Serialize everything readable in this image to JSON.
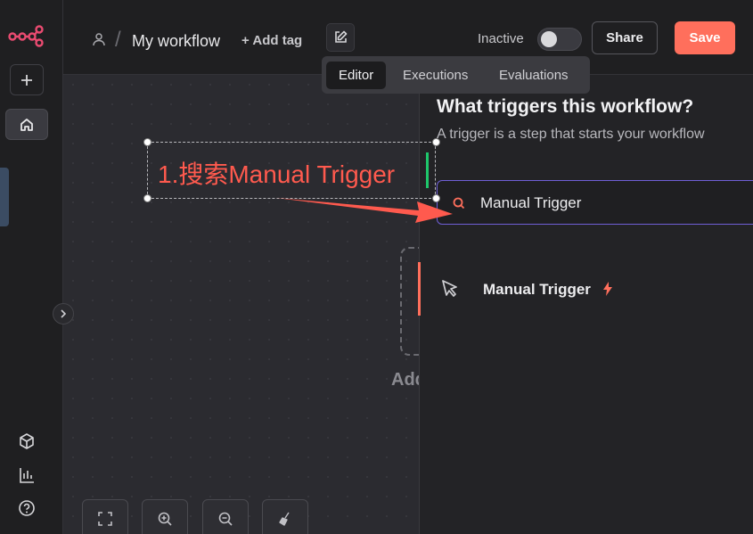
{
  "header": {
    "workflow_name": "My workflow",
    "add_tag_label": "+ Add tag",
    "status_label": "Inactive",
    "share_label": "Share",
    "save_label": "Save"
  },
  "tabs": [
    {
      "label": "Editor"
    },
    {
      "label": "Executions"
    },
    {
      "label": "Evaluations"
    }
  ],
  "canvas": {
    "add_trigger_label": "Add"
  },
  "annotation": {
    "text": "1.搜索Manual Trigger"
  },
  "panel": {
    "title": "What triggers this workflow?",
    "subtitle": "A trigger is a step that starts your workflow",
    "search_value": "Manual Trigger",
    "results": [
      {
        "label": "Manual Trigger"
      }
    ]
  },
  "colors": {
    "accent": "#ff6f5c",
    "search_border": "#6f5fd6",
    "annotation": "#ff5a4e"
  }
}
